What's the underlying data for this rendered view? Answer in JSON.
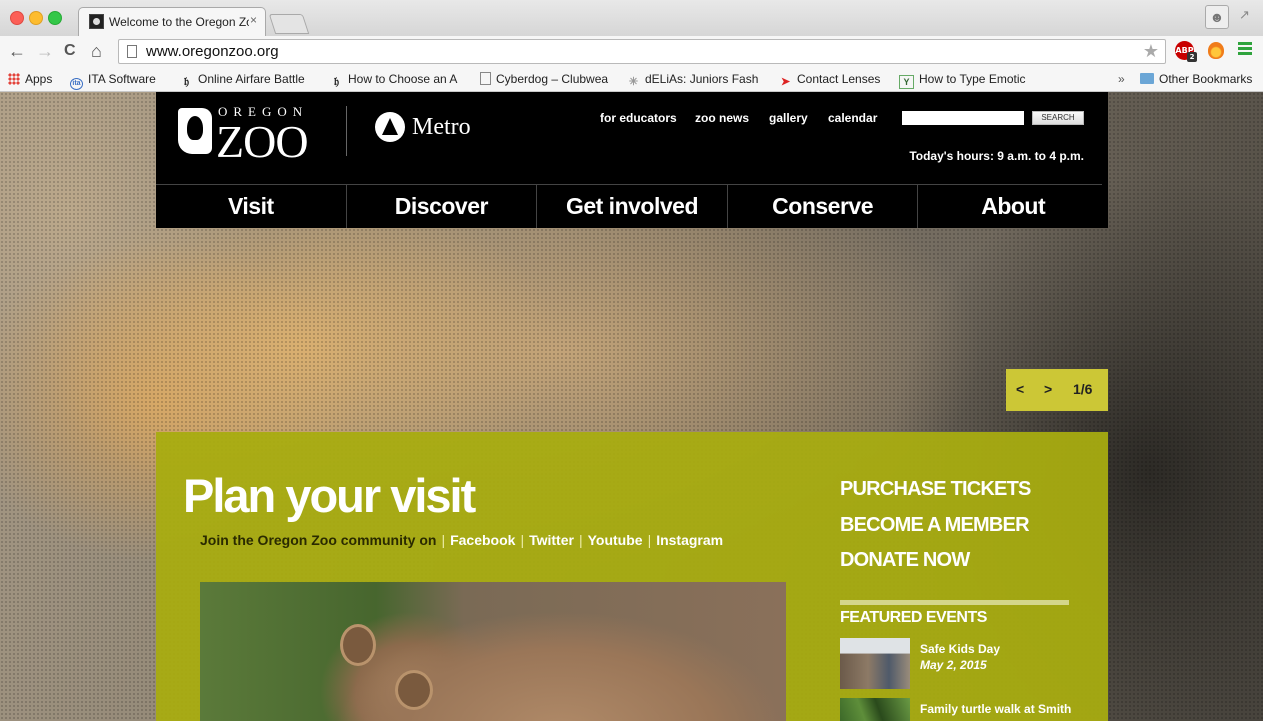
{
  "browser": {
    "tab_title": "Welcome to the Oregon Zo",
    "tab_close": "×",
    "url": "www.oregonzoo.org",
    "abp_badge": "ABP",
    "abp_count": "2",
    "nav": {
      "back": "←",
      "forward": "→",
      "reload": "C",
      "home": "⌂"
    },
    "bookmarks": [
      {
        "label": "Apps",
        "icon": "apps-grid-icon"
      },
      {
        "label": "ITA Software",
        "icon": "ita-icon"
      },
      {
        "label": "Online Airfare Battle",
        "icon": "site-icon"
      },
      {
        "label": "How to Choose an A",
        "icon": "site-icon"
      },
      {
        "label": "Cyberdog – Clubwea",
        "icon": "page-icon"
      },
      {
        "label": "dELiAs: Juniors Fash",
        "icon": "delias-icon"
      },
      {
        "label": "Contact Lenses",
        "icon": "contact-icon"
      },
      {
        "label": "How to Type Emotic",
        "icon": "site-icon"
      }
    ],
    "bookmarks_overflow": "»",
    "other_bookmarks": "Other Bookmarks"
  },
  "site": {
    "logo": {
      "top": "OREGON",
      "main": "ZOO"
    },
    "partner": "Metro",
    "utility_links": [
      "for educators",
      "zoo news",
      "gallery",
      "calendar"
    ],
    "search": {
      "placeholder": "",
      "button": "SEARCH"
    },
    "hours": "Today's hours: 9 a.m. to 4 p.m.",
    "main_nav": [
      "Visit",
      "Discover",
      "Get involved",
      "Conserve",
      "About"
    ],
    "slider": {
      "prev": "<",
      "next": ">",
      "counter": "1/6",
      "color": "#ccc736"
    },
    "panel": {
      "color": "#a8ac10",
      "title": "Plan your visit",
      "social_lead": "Join the Oregon Zoo community on",
      "social_links": [
        "Facebook",
        "Twitter",
        "Youtube",
        "Instagram"
      ],
      "actions": [
        "PURCHASE TICKETS",
        "BECOME A MEMBER",
        "DONATE NOW"
      ],
      "featured_title": "FEATURED EVENTS",
      "events": [
        {
          "name": "Safe Kids Day",
          "date": "May 2, 2015"
        },
        {
          "name": "Family turtle walk at Smith",
          "date": ""
        }
      ]
    }
  }
}
